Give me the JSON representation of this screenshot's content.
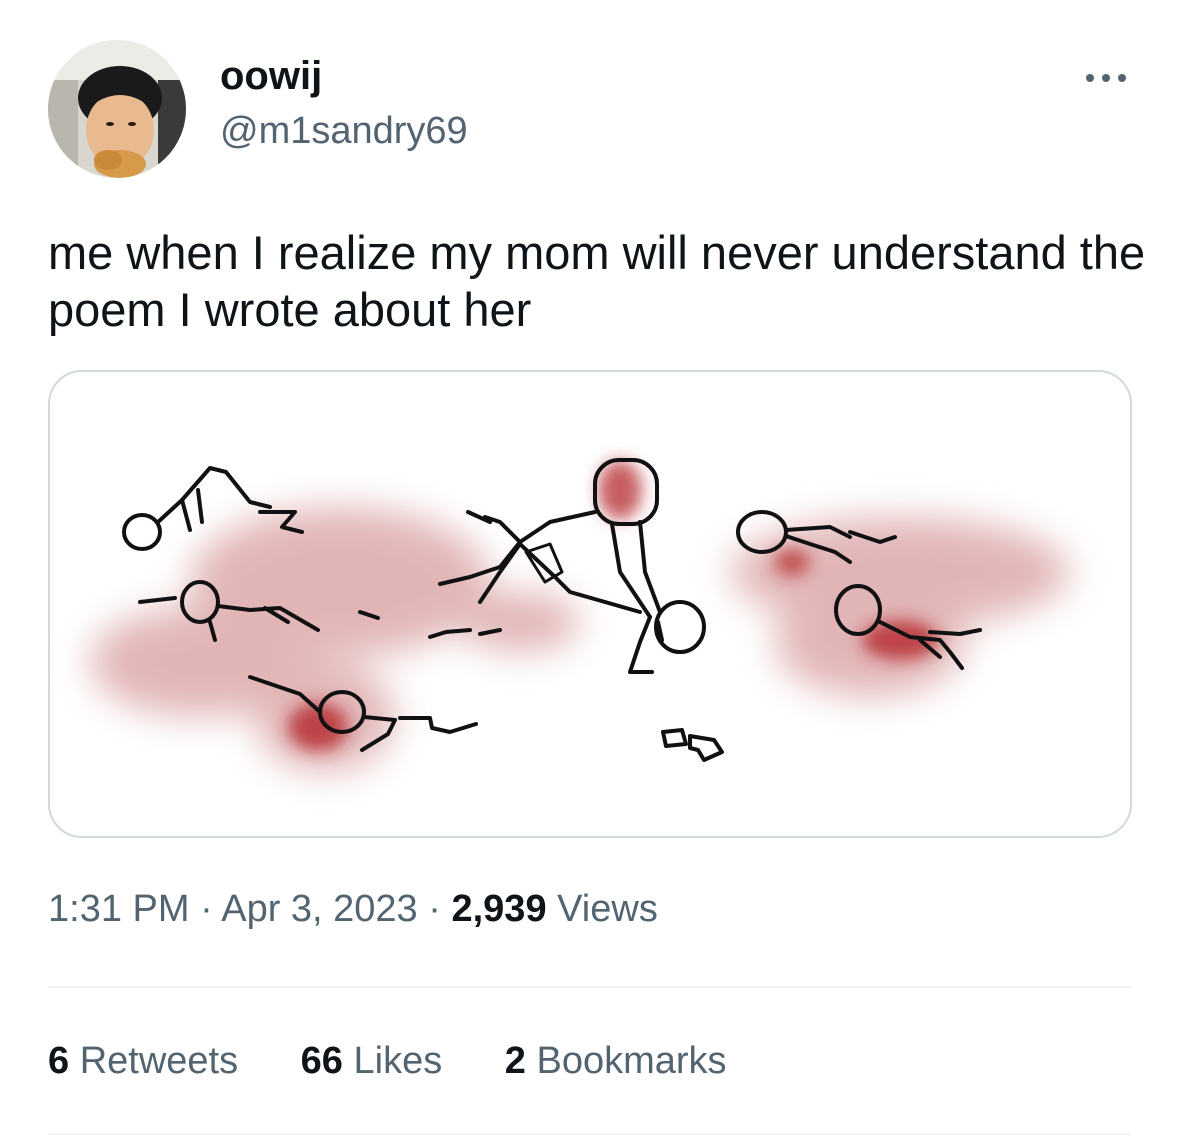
{
  "user": {
    "display_name": "oowij",
    "handle": "@m1sandry69"
  },
  "tweet": {
    "text": "me when I realize my mom will never understand the poem I wrote about her",
    "time": "1:31 PM",
    "date": "Apr 3, 2023",
    "separator": "·",
    "views_count": "2,939",
    "views_label": "Views"
  },
  "stats": [
    {
      "count": "6",
      "label": "Retweets"
    },
    {
      "count": "66",
      "label": "Likes"
    },
    {
      "count": "2",
      "label": "Bookmarks"
    }
  ],
  "icons": {
    "more": "more-horizontal-icon"
  },
  "colors": {
    "text_primary": "#0f1419",
    "text_secondary": "#536471",
    "border": "#cfd9de",
    "divider": "#eff3f4",
    "blood": "#b4282b"
  }
}
